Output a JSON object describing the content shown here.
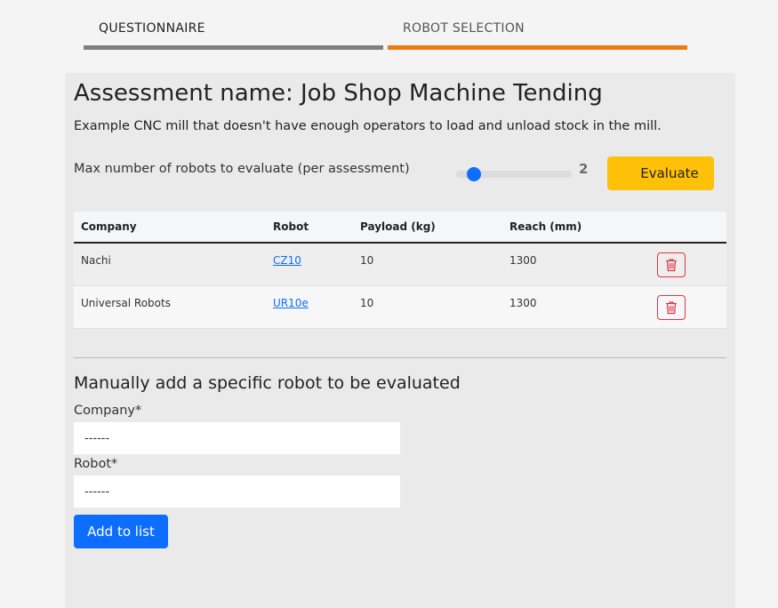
{
  "tabs": [
    {
      "label": "QUESTIONNAIRE"
    },
    {
      "label": "ROBOT SELECTION"
    }
  ],
  "assessment": {
    "title": "Assessment name: Job Shop Machine Tending",
    "description": "Example CNC mill that doesn't have enough operators to load and unload stock in the mill."
  },
  "slider": {
    "label": "Max number of robots to evaluate (per assessment)",
    "value": "2",
    "fraction": 0.0
  },
  "evaluate_label": "Evaluate",
  "table": {
    "headers": [
      "Company",
      "Robot",
      "Payload (kg)",
      "Reach (mm)"
    ],
    "rows": [
      {
        "company": "Nachi",
        "robot": "CZ10",
        "payload": "10",
        "reach": "1300"
      },
      {
        "company": "Universal Robots",
        "robot": "UR10e",
        "payload": "10",
        "reach": "1300"
      }
    ]
  },
  "manual": {
    "title": "Manually add a specific robot to be evaluated",
    "company_label": "Company*",
    "company_value": "------",
    "robot_label": "Robot*",
    "robot_value": "------",
    "add_label": "Add to list"
  },
  "colors": {
    "accent_orange": "#f07b13",
    "evaluate_yellow": "#ffc107",
    "primary_blue": "#0d6efd",
    "danger_red": "#dc3545"
  },
  "icons": {
    "delete": "trash-icon"
  }
}
